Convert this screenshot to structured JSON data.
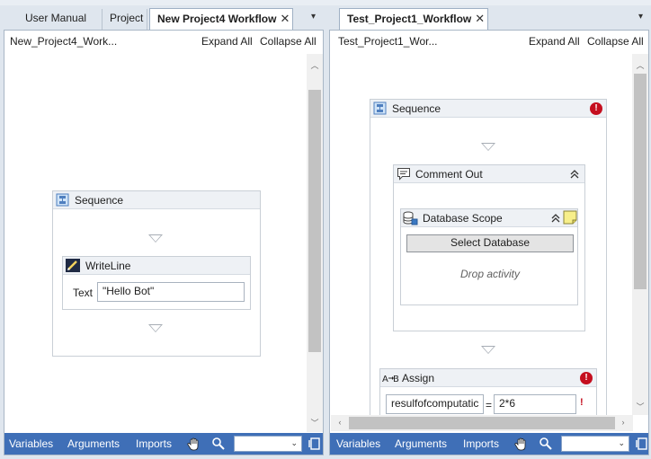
{
  "tabs": {
    "user_manual": "User Manual",
    "project": "Project",
    "new_project4": "New Project4 Workflow",
    "test_project1": "Test_Project1_Workflow",
    "close_glyph": "✕",
    "menu_glyph": "▾"
  },
  "left_panel": {
    "workflow_name": "New_Project4_Work...",
    "expand_all": "Expand All",
    "collapse_all": "Collapse All",
    "sequence_title": "Sequence",
    "writeline_title": "WriteLine",
    "text_label": "Text",
    "text_value": "\"Hello Bot\""
  },
  "right_panel": {
    "workflow_name": "Test_Project1_Wor...",
    "expand_all": "Expand All",
    "collapse_all": "Collapse All",
    "sequence_title": "Sequence",
    "comment_out_title": "Comment Out",
    "database_scope_title": "Database Scope",
    "select_database": "Select Database",
    "drop_activity": "Drop activity",
    "assign_title": "Assign",
    "assign_to": "resulfofcomputatic",
    "assign_equals": "=",
    "assign_value": "2*6",
    "error_glyph": "!"
  },
  "bottom_bar": {
    "variables": "Variables",
    "arguments": "Arguments",
    "imports": "Imports"
  },
  "icons": {
    "pan": "hand-pan-icon",
    "zoom": "magnifier-icon",
    "fit": "fit-to-screen-icon"
  },
  "colors": {
    "bottom_bar": "#3f6fb7",
    "error": "#c50f1f",
    "panel_border": "#a9b7c6"
  }
}
